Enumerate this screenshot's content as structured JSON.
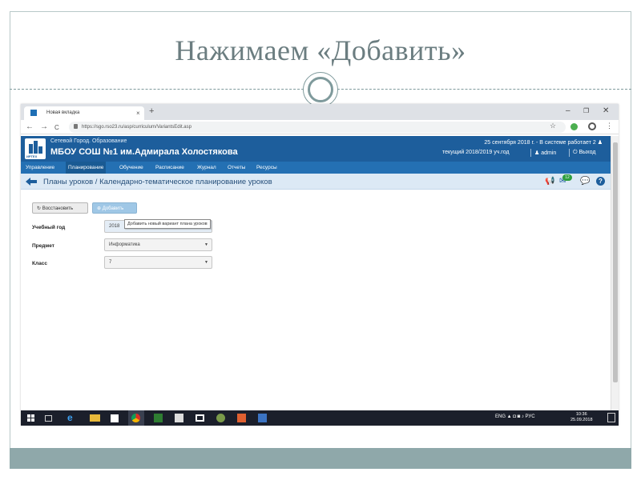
{
  "slide_title": "Нажимаем «Добавить»",
  "browser": {
    "tab_title": "Новая вкладка",
    "tab_close": "×",
    "new_tab": "+",
    "url": "https://sgo.rso23.ru/asp/curriculum/VariantsEdit.asp",
    "back": "←",
    "forward": "→",
    "reload": "C",
    "minimize": "–",
    "restore": "❐",
    "close": "✕",
    "star": "☆",
    "menu": "⋮"
  },
  "site": {
    "logo_text": "ИРТЕХ",
    "system_name": "Сетевой Город. Образование",
    "school_name": "МБОУ СОШ №1 им.Адмирала Холостякова",
    "date_status": "25 сентября 2018 г. - В системе работает 2",
    "current_year": "текущий 2018/2019 уч.год",
    "user": "admin",
    "logout": "Выход"
  },
  "menu": [
    {
      "label": "Управление"
    },
    {
      "label": "Планирование"
    },
    {
      "label": "Обучение"
    },
    {
      "label": "Расписание"
    },
    {
      "label": "Журнал"
    },
    {
      "label": "Отчеты"
    },
    {
      "label": "Ресурсы"
    }
  ],
  "breadcrumb": "Планы уроков / Календарно-тематическое планирование уроков",
  "messages_badge": "12",
  "buttons": {
    "restore": "Восстановить",
    "add": "Добавить"
  },
  "tooltip": "Добавить новый вариант плана уроков",
  "form": {
    "year_label": "Учебный год",
    "year_value": "2018",
    "subject_label": "Предмет",
    "subject_value": "Информатика",
    "class_label": "Класс",
    "class_value": "7"
  },
  "taskbar": {
    "tray": "ENG  ▲ ◘ ◙ ♪ РУС",
    "tray_lang": "РУС",
    "time": "10:36",
    "date": "25.09.2018"
  },
  "colors": {
    "header_blue": "#1d5e9c",
    "menu_blue": "#2470b3",
    "slide_band": "#8fa8aa",
    "title_gray": "#6b7d80"
  }
}
